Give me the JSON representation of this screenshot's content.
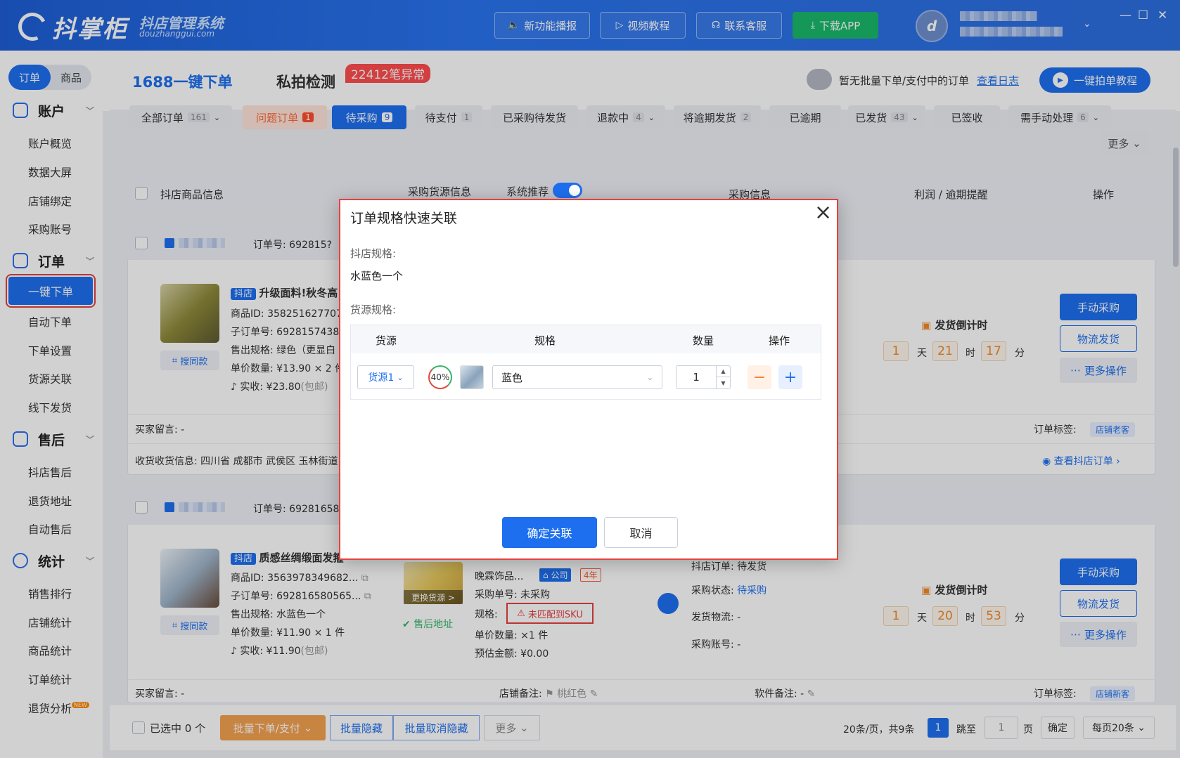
{
  "brand": {
    "name": "抖掌柜",
    "subtitle": "抖店管理系统",
    "url": "douzhanggui.com"
  },
  "topbar": {
    "buttons": [
      "新功能播报",
      "视频教程",
      "联系客服",
      "下载APP"
    ],
    "window_controls": [
      "—",
      "☐",
      "✕"
    ]
  },
  "sidebar": {
    "segment": {
      "order": "订单",
      "goods": "商品"
    },
    "sections": [
      {
        "title": "账户",
        "items": [
          "账户概览",
          "数据大屏",
          "店铺绑定",
          "采购账号"
        ]
      },
      {
        "title": "订单",
        "items": [
          "一键下单",
          "自动下单",
          "下单设置",
          "货源关联",
          "线下发货"
        ]
      },
      {
        "title": "售后",
        "items": [
          "抖店售后",
          "退货地址",
          "自动售后"
        ]
      },
      {
        "title": "统计",
        "items": [
          "销售排行",
          "店铺统计",
          "商品统计",
          "订单统计",
          "退货分析"
        ]
      }
    ],
    "active": "一键下单",
    "new_badge": "NEW"
  },
  "header": {
    "tab_main": "1688一键下单",
    "tab_private": "私拍检测",
    "abnormal_badge": "22412笔异常",
    "no_batch": "暂无批量下单/支付中的订单",
    "view_log": "查看日志",
    "tutorial": "一键拍单教程"
  },
  "filter_tabs": [
    {
      "label": "全部订单",
      "count": "161",
      "chev": true
    },
    {
      "label": "问题订单",
      "count": "1"
    },
    {
      "label": "待采购",
      "count": "9"
    },
    {
      "label": "待支付",
      "count": "1"
    },
    {
      "label": "已采购待发货",
      "count": ""
    },
    {
      "label": "退款中",
      "count": "4",
      "chev": true
    },
    {
      "label": "将逾期发货",
      "count": "2"
    },
    {
      "label": "已逾期",
      "count": ""
    },
    {
      "label": "已发货",
      "count": "43",
      "chev": true
    },
    {
      "label": "已签收",
      "count": ""
    },
    {
      "label": "需手动处理",
      "count": "6",
      "chev": true
    }
  ],
  "more": "更多",
  "table_headers": {
    "product": "抖店商品信息",
    "source": "采购货源信息",
    "recommend": "系统推荐",
    "purchase": "采购信息",
    "profit": "利润 / 逾期提醒",
    "action": "操作"
  },
  "orders": [
    {
      "order_no_label": "订单号:",
      "order_no": "692815?",
      "shop_badge": "抖店",
      "title": "升级面料!秋冬高",
      "product_id": "商品ID: 358251627707",
      "sub_order": "子订单号: 6928157438",
      "spec": "售出规格: 绿色（更显白",
      "unit": "单价数量: ¥13.90 × 2 件",
      "paid": "实收: ¥23.80",
      "paid_note": "(包邮)",
      "search_same": "搜同款",
      "buyer_msg": "买家留言: -",
      "address": "收货收货信息:  四川省 成都市 武侯区 玉林街道",
      "order_tag_label": "订单标签:",
      "order_tag": "店铺老客",
      "view_order": "查看抖店订单",
      "countdown_title": "发货倒计时",
      "countdown": {
        "d": "1",
        "h": "21",
        "m": "17"
      },
      "buttons": [
        "手动采购",
        "物流发货",
        "更多操作"
      ]
    },
    {
      "order_no_label": "订单号:",
      "order_no": "69281658",
      "shop_badge": "抖店",
      "title": "质感丝绸缎面发箍",
      "product_id": "商品ID: 3563978349682...",
      "sub_order": "子订单号: 692816580565...",
      "spec": "售出规格: 水蓝色一个",
      "unit": "单价数量: ¥11.90 × 1 件",
      "paid": "实收: ¥11.90",
      "paid_note": "(包邮)",
      "search_same": "搜同款",
      "change_source": "更换货源 >",
      "after_sale_addr": "售后地址",
      "supplier": "晚霖饰品...",
      "company": "公司",
      "years": "4年",
      "purchase_no": "采购单号: 未采购",
      "spec_label": "规格:",
      "unmatched": "未匹配到SKU",
      "qty": "单价数量: ×1 件",
      "estimate": "预估金额: ¥0.00",
      "shop_order": "抖店订单: 待发货",
      "purchase_status_label": "采购状态:",
      "purchase_status": "待采购",
      "logistics": "发货物流: -",
      "purchase_acct": "采购账号: -",
      "buyer_msg": "买家留言: -",
      "shop_note_label": "店铺备注:",
      "shop_note": "桃红色",
      "soft_note": "软件备注: -",
      "order_tag_label": "订单标签:",
      "order_tag": "店铺新客",
      "countdown_title": "发货倒计时",
      "countdown": {
        "d": "1",
        "h": "20",
        "m": "53"
      },
      "buttons": [
        "手动采购",
        "物流发货",
        "更多操作"
      ]
    }
  ],
  "countdown_units": {
    "d": "天",
    "h": "时",
    "m": "分"
  },
  "bottom": {
    "selected": "已选中 0 个",
    "batch_order": "批量下单/支付",
    "batch_hide": "批量隐藏",
    "batch_unhide": "批量取消隐藏",
    "more": "更多",
    "page_info": "20条/页，共9条",
    "page_current": "1",
    "jump": "跳至",
    "jump_value": "1",
    "page_unit": "页",
    "confirm": "确定",
    "per_page": "每页20条"
  },
  "modal": {
    "title": "订单规格快速关联",
    "shop_spec_label": "抖店规格:",
    "shop_spec_value": "水蓝色一个",
    "source_spec_label": "货源规格:",
    "columns": [
      "货源",
      "规格",
      "数量",
      "操作"
    ],
    "row": {
      "source": "货源1",
      "match": "40%",
      "spec": "蓝色",
      "qty": "1"
    },
    "confirm": "确定关联",
    "cancel": "取消"
  }
}
